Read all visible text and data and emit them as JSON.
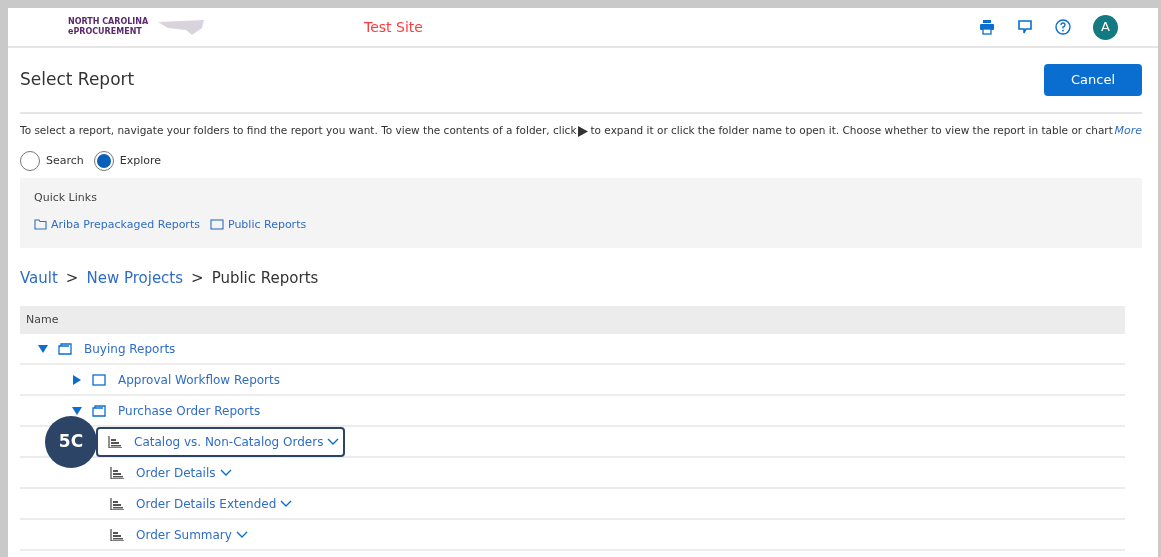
{
  "header": {
    "logo_lines": [
      "NORTH CAROLINA",
      "ePROCUREMENT"
    ],
    "site_label": "Test Site",
    "avatar": "A"
  },
  "page_title": "Select Report",
  "cancel_button": "Cancel",
  "instructions": {
    "before": "To select a report, navigate your folders to find the report you want. To view the contents of a folder, click",
    "after": "to expand it or click the folder name to open it. Choose whether to view the report in table or chart",
    "more": "More"
  },
  "mode_options": [
    {
      "label": "Search",
      "selected": false
    },
    {
      "label": "Explore",
      "selected": true
    }
  ],
  "quick_links": {
    "title": "Quick Links",
    "links": [
      {
        "label": "Ariba Prepackaged Reports",
        "kind": "folder"
      },
      {
        "label": "Public Reports",
        "kind": "box"
      }
    ]
  },
  "breadcrumb_separator": ">",
  "breadcrumb": [
    {
      "label": "Vault",
      "link": true
    },
    {
      "label": "New Projects",
      "link": true
    },
    {
      "label": "Public Reports",
      "link": false
    }
  ],
  "table": {
    "columns": [
      "Name"
    ],
    "rows": [
      {
        "label": "Buying Reports",
        "kind": "folder",
        "expanded": true,
        "children": [
          {
            "label": "Approval Workflow Reports",
            "kind": "folder",
            "expanded": false
          },
          {
            "label": "Purchase Order Reports",
            "kind": "folder",
            "expanded": true,
            "children": [
              {
                "label": "Catalog vs. Non-Catalog Orders",
                "kind": "report",
                "highlighted": true
              },
              {
                "label": "Order Details",
                "kind": "report",
                "highlighted": false
              },
              {
                "label": "Order Details Extended",
                "kind": "report",
                "highlighted": false
              },
              {
                "label": "Order Summary",
                "kind": "report",
                "highlighted": false
              }
            ]
          }
        ]
      }
    ]
  },
  "callout": {
    "label": "5C"
  }
}
